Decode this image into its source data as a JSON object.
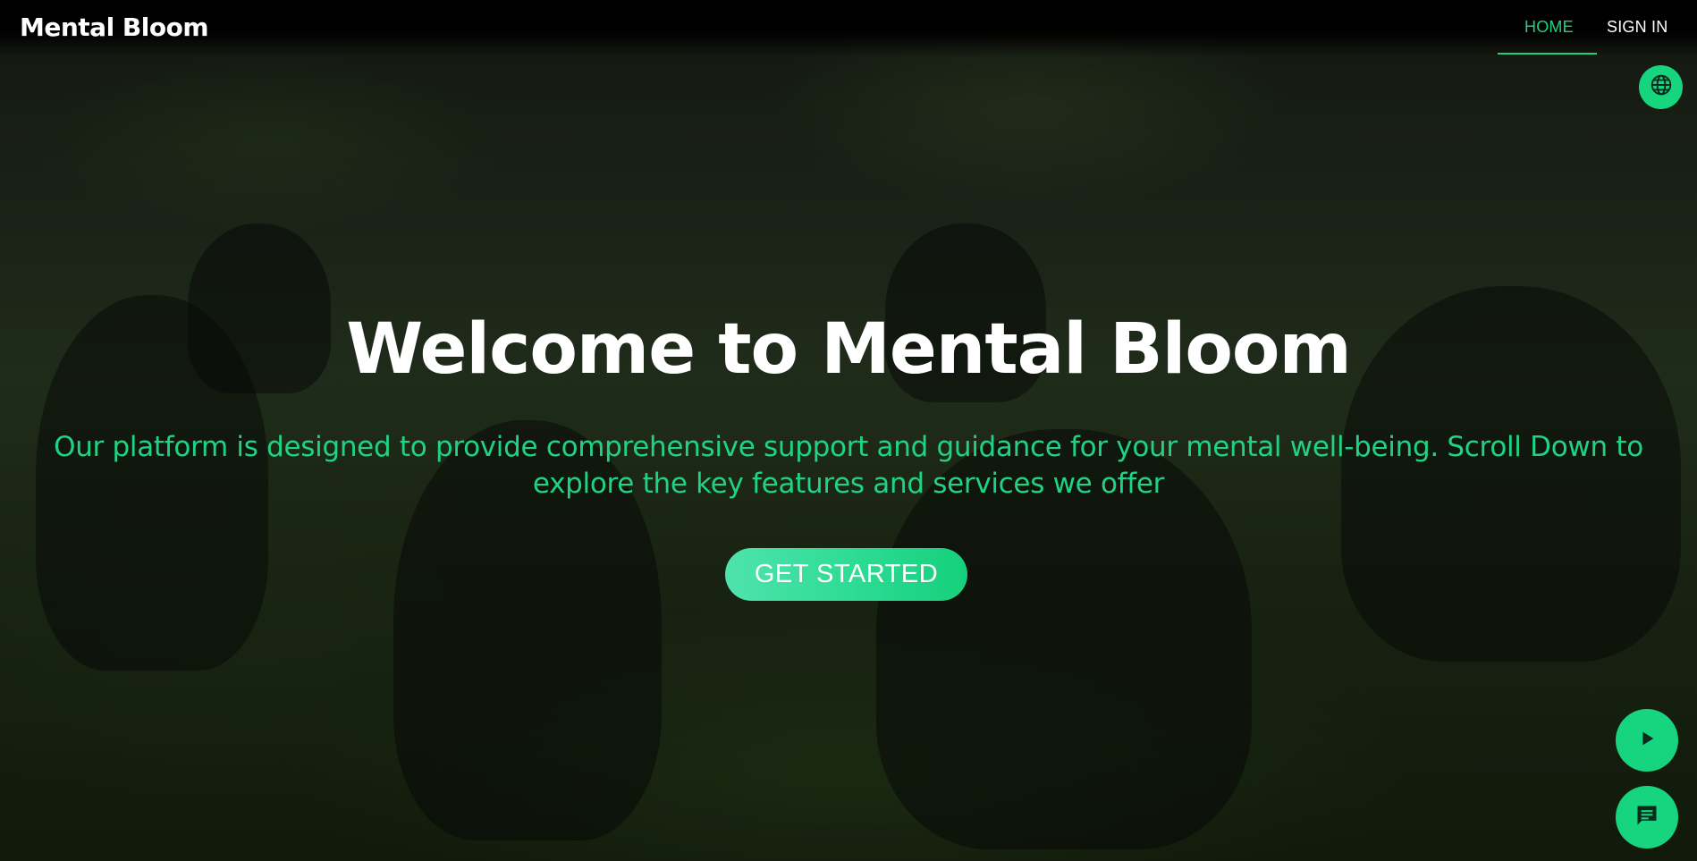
{
  "brand": {
    "name": "Mental Bloom"
  },
  "nav": {
    "items": [
      {
        "label": "HOME",
        "active": true
      },
      {
        "label": "SIGN IN",
        "active": false
      }
    ]
  },
  "hero": {
    "title": "Welcome to Mental Bloom",
    "subtitle": "Our platform is designed to provide comprehensive support and guidance for your mental well-being. Scroll Down to explore the key features and services we offer",
    "cta_label": "GET STARTED"
  },
  "icons": {
    "language": "globe-icon",
    "play": "play-icon",
    "chat": "chat-icon"
  },
  "colors": {
    "accent": "#1ed37f",
    "nav_bg": "#000000",
    "title": "#ffffff"
  }
}
